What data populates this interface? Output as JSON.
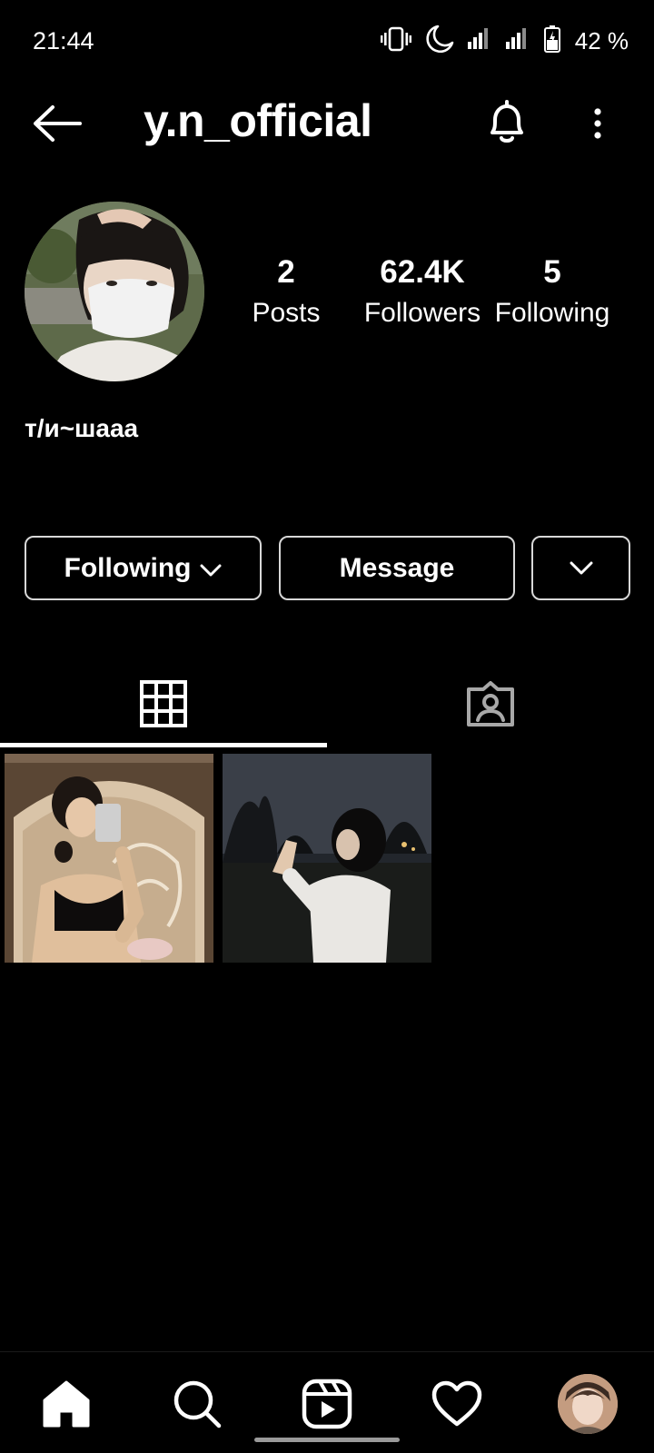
{
  "status_bar": {
    "time": "21:44",
    "battery": "42 %",
    "icons": [
      "vibrate-icon",
      "moon-icon",
      "signal-icon",
      "signal-icon",
      "battery-icon"
    ]
  },
  "header": {
    "username": "y.n_official",
    "icons": [
      "back-arrow-icon",
      "bell-icon",
      "more-vertical-icon"
    ]
  },
  "profile": {
    "stats": {
      "posts": {
        "value": "2",
        "label": "Posts"
      },
      "followers": {
        "value": "62.4K",
        "label": "Followers"
      },
      "following": {
        "value": "5",
        "label": "Following"
      }
    },
    "bio": "т/и~шааа"
  },
  "actions": {
    "following_label": "Following",
    "message_label": "Message"
  },
  "tabs": [
    {
      "name": "grid",
      "icon": "grid-icon",
      "selected": true
    },
    {
      "name": "tagged",
      "icon": "tagged-person-icon",
      "selected": false
    }
  ],
  "bottom_nav": {
    "items": [
      "home-icon",
      "search-icon",
      "reels-icon",
      "heart-icon",
      "profile-avatar"
    ]
  },
  "colors": {
    "background": "#000000",
    "text": "#ffffff",
    "button_border": "#d8d8d8",
    "inactive_icon": "#a8a8a8"
  }
}
